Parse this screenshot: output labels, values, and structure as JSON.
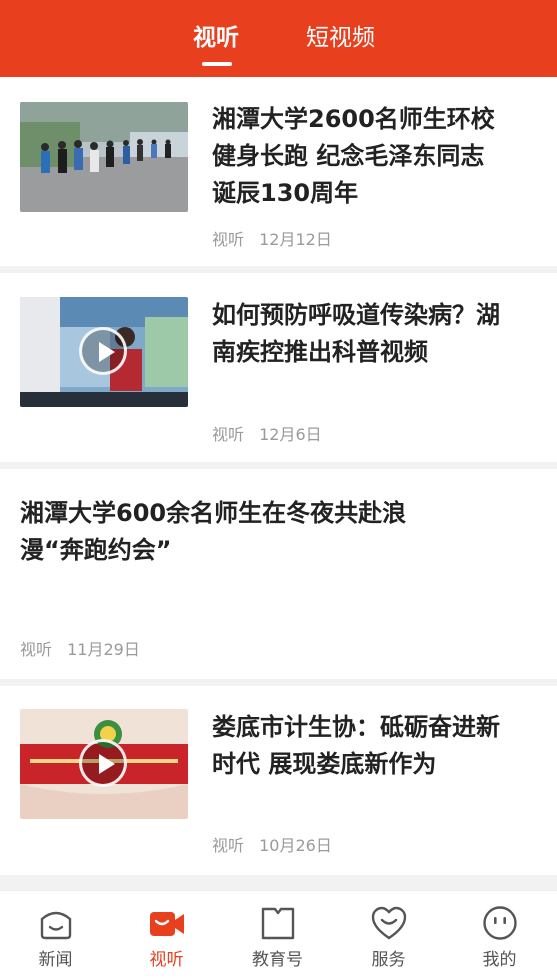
{
  "header": {
    "tabs": [
      {
        "label": "视听",
        "active": true
      },
      {
        "label": "短视频",
        "active": false
      }
    ],
    "accent_color": "#e8401e"
  },
  "articles": [
    {
      "title_line1": "湘潭大学2600名师生环校",
      "title_line2": "健身长跑 纪念毛泽东同志",
      "title_line3": "诞辰130周年",
      "source": "视听",
      "date": "12月12日",
      "thumbnail": "runners-photo",
      "video": false
    },
    {
      "title_line1": "如何预防呼吸道传染病？湖",
      "title_line2": "南疾控推出科普视频",
      "source": "视听",
      "date": "12月6日",
      "thumbnail": "presenter-video",
      "video": true
    },
    {
      "title_line1": "湘潭大学600余名师生在冬夜共赴浪",
      "title_line2": "漫“奔跑约会”",
      "source": "视听",
      "date": "11月29日",
      "thumbnail": "",
      "video": false
    },
    {
      "title_line1": "娄底市计生协：砥砺奋进新",
      "title_line2": "时代 展现娄底新作为",
      "source": "视听",
      "date": "10月26日",
      "thumbnail": "red-banner-video",
      "video": true
    }
  ],
  "tabbar": {
    "items": [
      {
        "label": "新闻",
        "icon": "news-icon",
        "active": false
      },
      {
        "label": "视听",
        "icon": "video-camera-icon",
        "active": true
      },
      {
        "label": "教育号",
        "icon": "book-icon",
        "active": false
      },
      {
        "label": "服务",
        "icon": "heart-icon",
        "active": false
      },
      {
        "label": "我的",
        "icon": "smiley-icon",
        "active": false
      }
    ]
  }
}
